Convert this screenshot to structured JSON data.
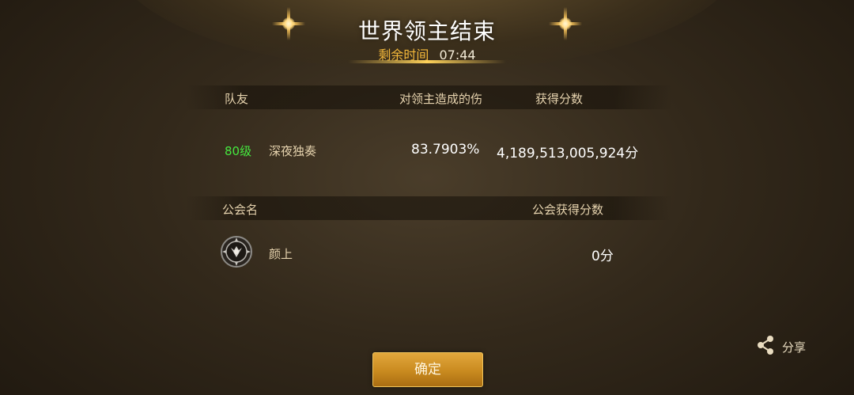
{
  "header": {
    "title": "世界领主结束",
    "timer_label": "剩余时间",
    "timer_value": "07:44"
  },
  "team_table": {
    "columns": {
      "teammate": "队友",
      "damage": "对领主造成的伤",
      "score": "获得分数"
    },
    "rows": [
      {
        "level": "80级",
        "name": "深夜独奏",
        "damage": "83.7903%",
        "score": "4,189,513,005,924分"
      }
    ]
  },
  "guild_table": {
    "columns": {
      "guild_name": "公会名",
      "guild_score": "公会获得分数"
    },
    "rows": [
      {
        "emblem_icon": "guild-emblem-icon",
        "name": "颜上",
        "score": "0分"
      }
    ]
  },
  "buttons": {
    "confirm": "确定",
    "share": "分享"
  },
  "colors": {
    "accent_gold": "#f5b93a",
    "level_green": "#45e83f",
    "button_gold": "#c98a1f"
  }
}
